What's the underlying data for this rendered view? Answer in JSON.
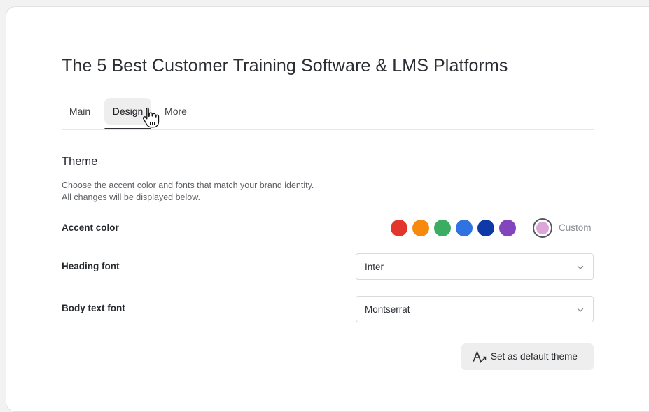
{
  "page": {
    "title": "The 5 Best Customer Training Software & LMS Platforms"
  },
  "tabs": [
    {
      "label": "Main"
    },
    {
      "label": "Design",
      "active": true
    },
    {
      "label": "More"
    }
  ],
  "theme": {
    "heading": "Theme",
    "description_line1": "Choose the accent color and fonts that match your brand identity.",
    "description_line2": "All changes will be displayed below."
  },
  "accent": {
    "label": "Accent color",
    "colors": [
      "#e2352b",
      "#f7890e",
      "#3aad62",
      "#2f72e2",
      "#0f38a8",
      "#8245bd"
    ],
    "custom_color": "#dda6d9",
    "custom_label": "Custom"
  },
  "heading_font": {
    "label": "Heading font",
    "value": "Inter"
  },
  "body_font": {
    "label": "Body text font",
    "value": "Montserrat"
  },
  "default_button": {
    "label": "Set as default theme",
    "icon": "text-format-icon"
  }
}
